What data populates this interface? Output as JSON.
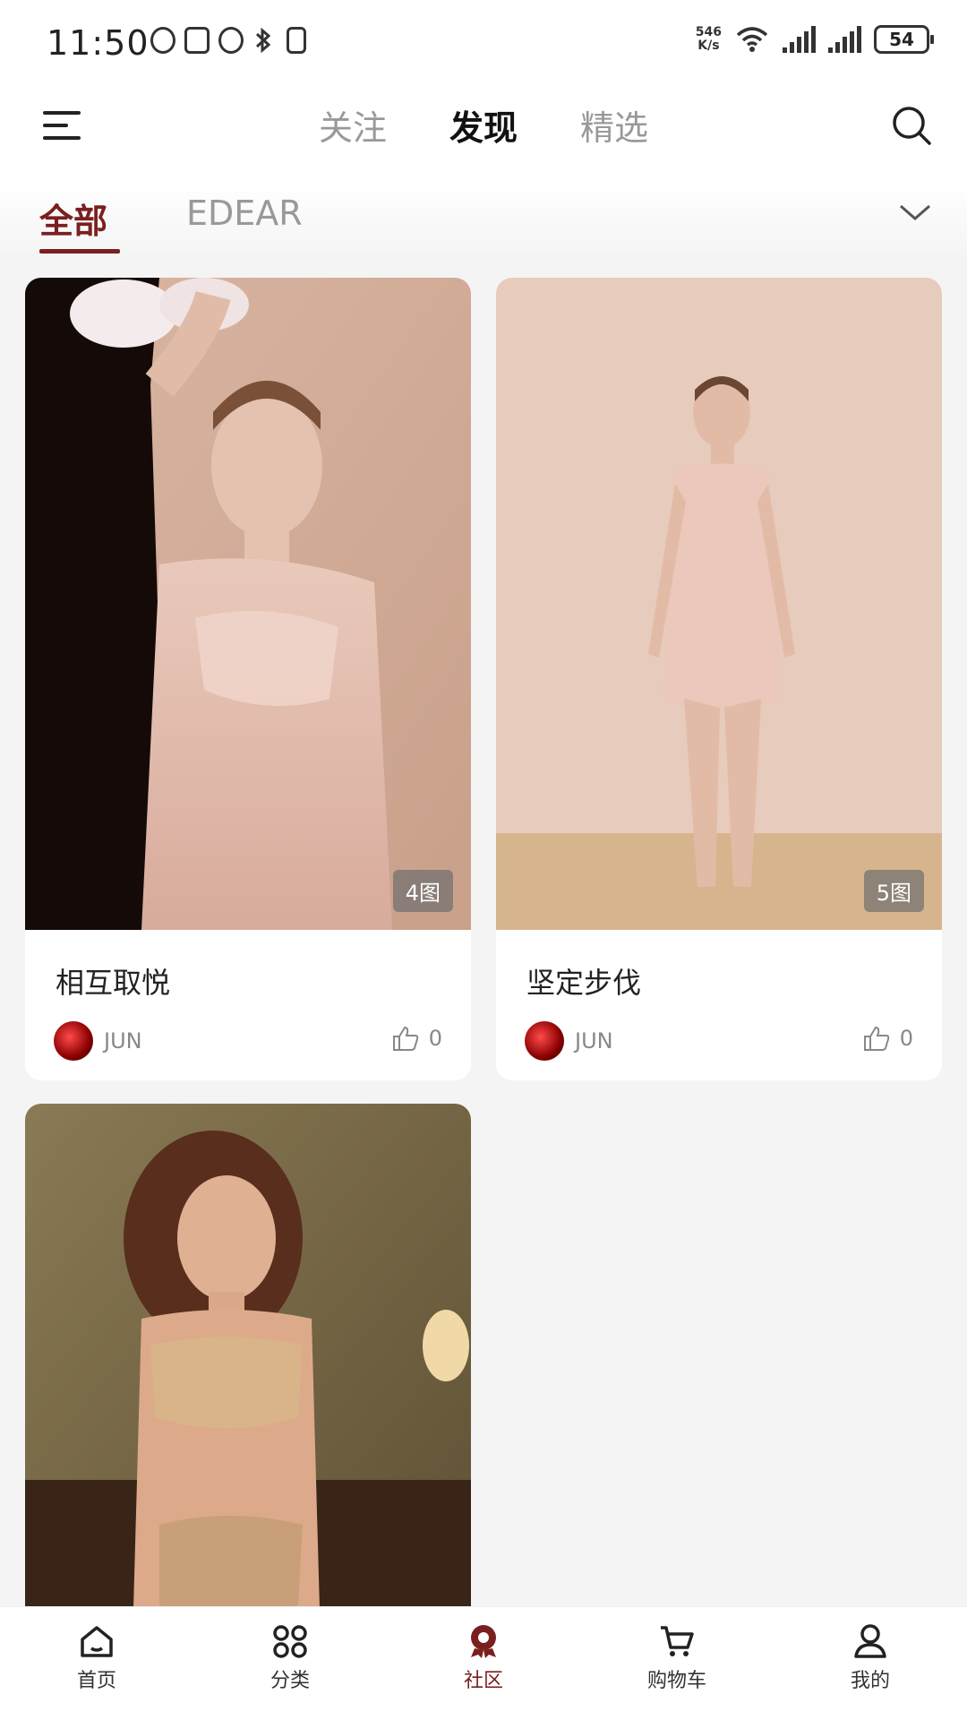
{
  "status_bar": {
    "time": "11:50",
    "net_speed_top": "546",
    "net_speed_bottom": "K/s",
    "battery": "54"
  },
  "top_nav": {
    "tabs": [
      {
        "label": "关注",
        "active": false
      },
      {
        "label": "发现",
        "active": true
      },
      {
        "label": "精选",
        "active": false
      }
    ]
  },
  "sub_tabs": [
    {
      "label": "全部",
      "active": true
    },
    {
      "label": "EDEAR",
      "active": false
    }
  ],
  "posts": [
    {
      "title": "相互取悦",
      "image_count": "4图",
      "author": "JUN",
      "likes": "0"
    },
    {
      "title": "坚定步伐",
      "image_count": "5图",
      "author": "JUN",
      "likes": "0"
    },
    {
      "title": "",
      "image_count": "",
      "author": "",
      "likes": ""
    }
  ],
  "bottom_nav": [
    {
      "label": "首页",
      "icon": "home-icon"
    },
    {
      "label": "分类",
      "icon": "grid-icon"
    },
    {
      "label": "社区",
      "icon": "community-icon",
      "active": true
    },
    {
      "label": "购物车",
      "icon": "cart-icon"
    },
    {
      "label": "我的",
      "icon": "user-icon"
    }
  ],
  "colors": {
    "accent": "#7a1f1f",
    "background": "#f4f4f4"
  }
}
